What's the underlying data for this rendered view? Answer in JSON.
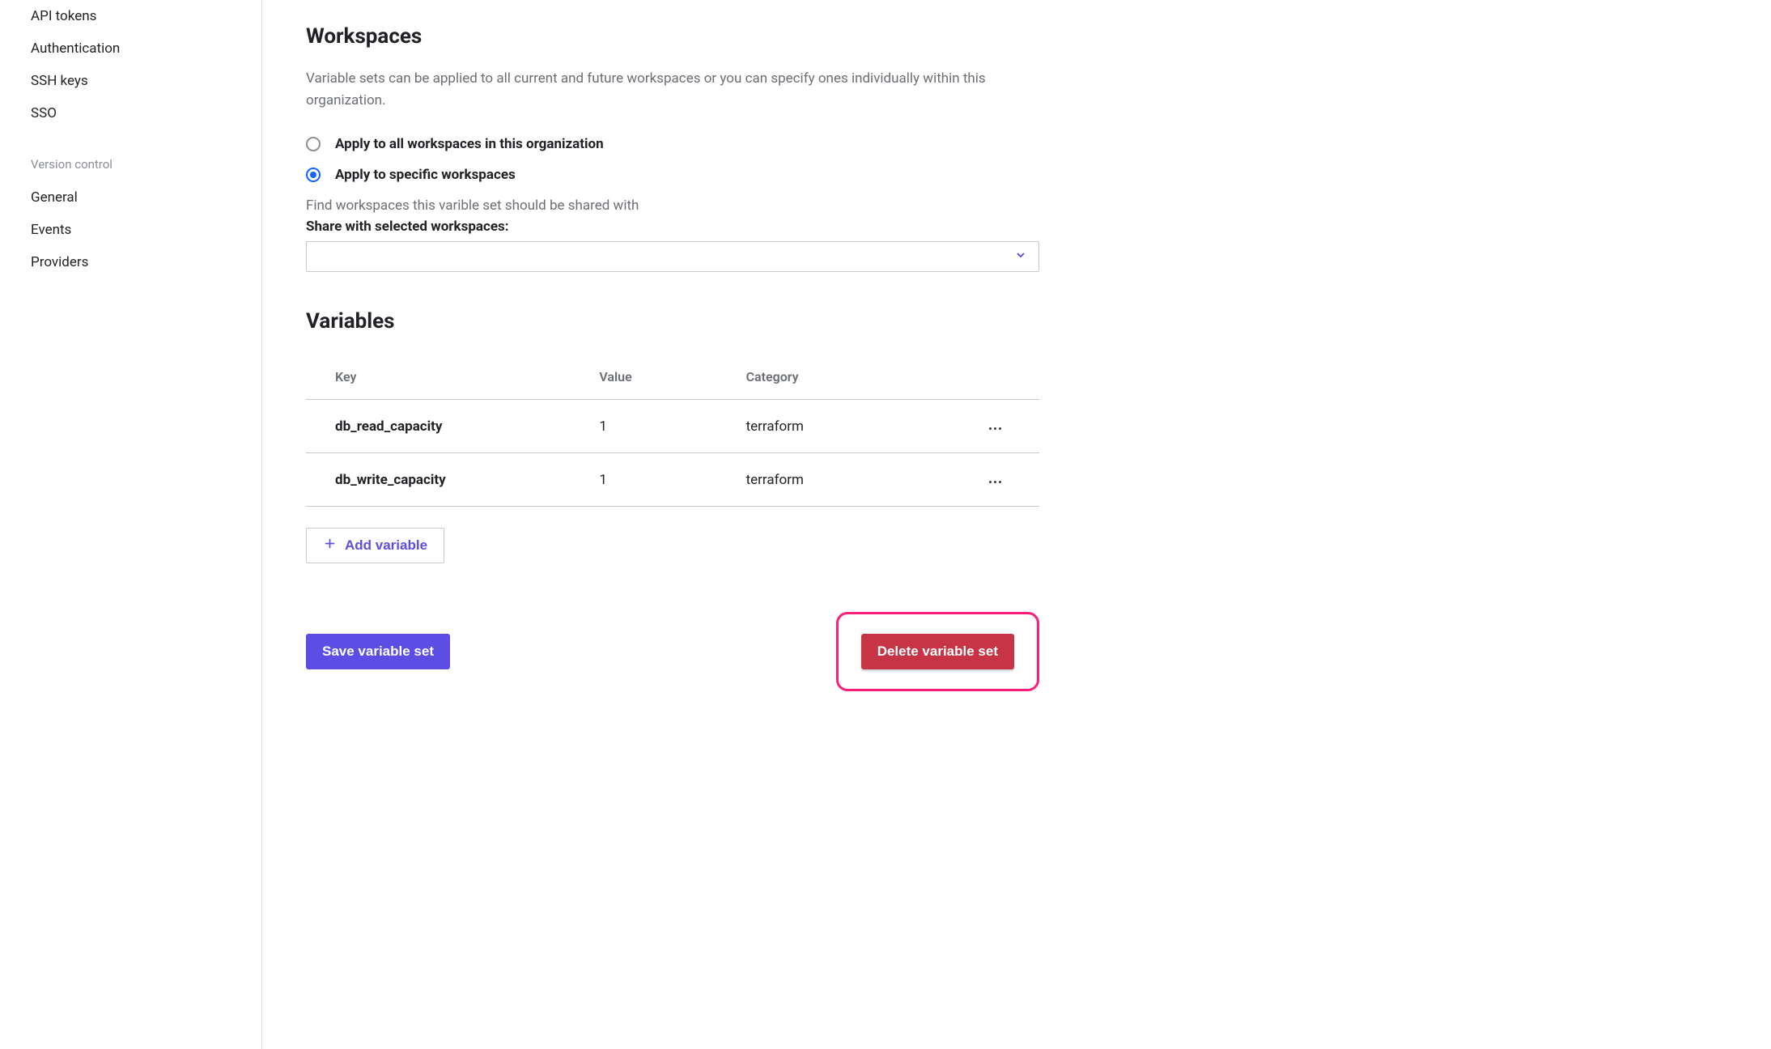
{
  "sidebar": {
    "items": [
      {
        "label": "API tokens"
      },
      {
        "label": "Authentication"
      },
      {
        "label": "SSH keys"
      },
      {
        "label": "SSO"
      }
    ],
    "group_label": "Version control",
    "vc_items": [
      {
        "label": "General"
      },
      {
        "label": "Events"
      },
      {
        "label": "Providers"
      }
    ]
  },
  "workspaces": {
    "title": "Workspaces",
    "description": "Variable sets can be applied to all current and future workspaces or you can specify ones individually within this organization.",
    "radio_all": "Apply to all workspaces in this organization",
    "radio_specific": "Apply to specific workspaces",
    "hint": "Find workspaces this varible set should be shared with",
    "share_label": "Share with selected workspaces:",
    "selected_value": ""
  },
  "variables": {
    "title": "Variables",
    "columns": {
      "key": "Key",
      "value": "Value",
      "category": "Category"
    },
    "rows": [
      {
        "key": "db_read_capacity",
        "value": "1",
        "category": "terraform"
      },
      {
        "key": "db_write_capacity",
        "value": "1",
        "category": "terraform"
      }
    ],
    "add_label": "Add variable"
  },
  "footer": {
    "save": "Save variable set",
    "delete": "Delete variable set"
  }
}
